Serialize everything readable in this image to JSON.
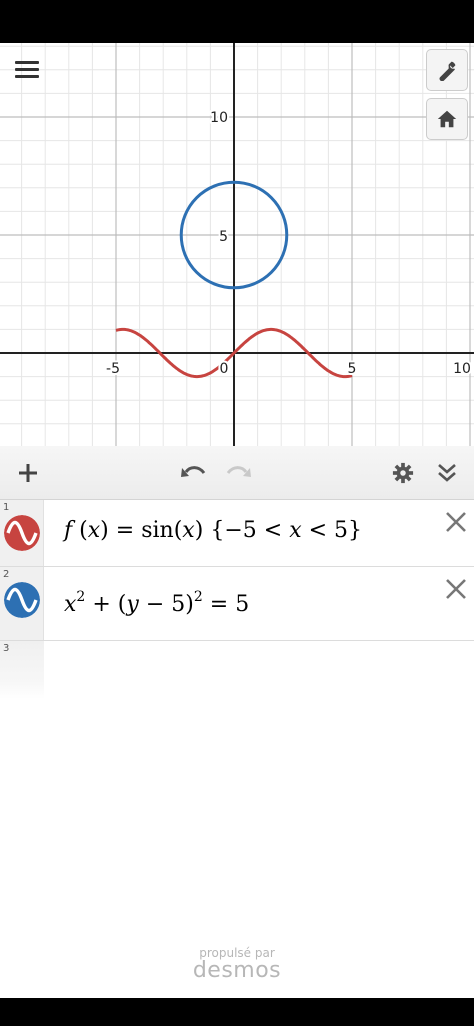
{
  "graph": {
    "x_ticks": [
      "-5",
      "0",
      "5",
      "10"
    ],
    "y_ticks": [
      "10",
      "5"
    ],
    "axis_color": "#222222",
    "grid_major_color": "#bdbdbd",
    "grid_minor_color": "#e6e6e6"
  },
  "graph_controls": {
    "menu_icon": "hamburger-icon",
    "settings_icon": "wrench-icon",
    "home_icon": "home-icon"
  },
  "toolbar": {
    "add_icon": "plus-icon",
    "undo_icon": "undo-icon",
    "redo_icon": "redo-icon",
    "settings_icon": "gear-icon",
    "collapse_icon": "double-chevron-down-icon"
  },
  "expressions": [
    {
      "number": "1",
      "color": "#c74440",
      "f": "f",
      "x": "x",
      "eq": "=",
      "fn": "sin",
      "arg": "x",
      "lo": "−5",
      "lt1": "<",
      "var": "x",
      "lt2": "<",
      "hi": "5"
    },
    {
      "number": "2",
      "color": "#2d70b3",
      "x": "x",
      "exp1": "2",
      "plus": "+",
      "y": "y",
      "minus": "−",
      "k": "5",
      "exp2": "2",
      "eq": "=",
      "r": "5"
    },
    {
      "number": "3"
    }
  ],
  "branding": {
    "caption": "propulsé par",
    "logo": "desmos"
  }
}
